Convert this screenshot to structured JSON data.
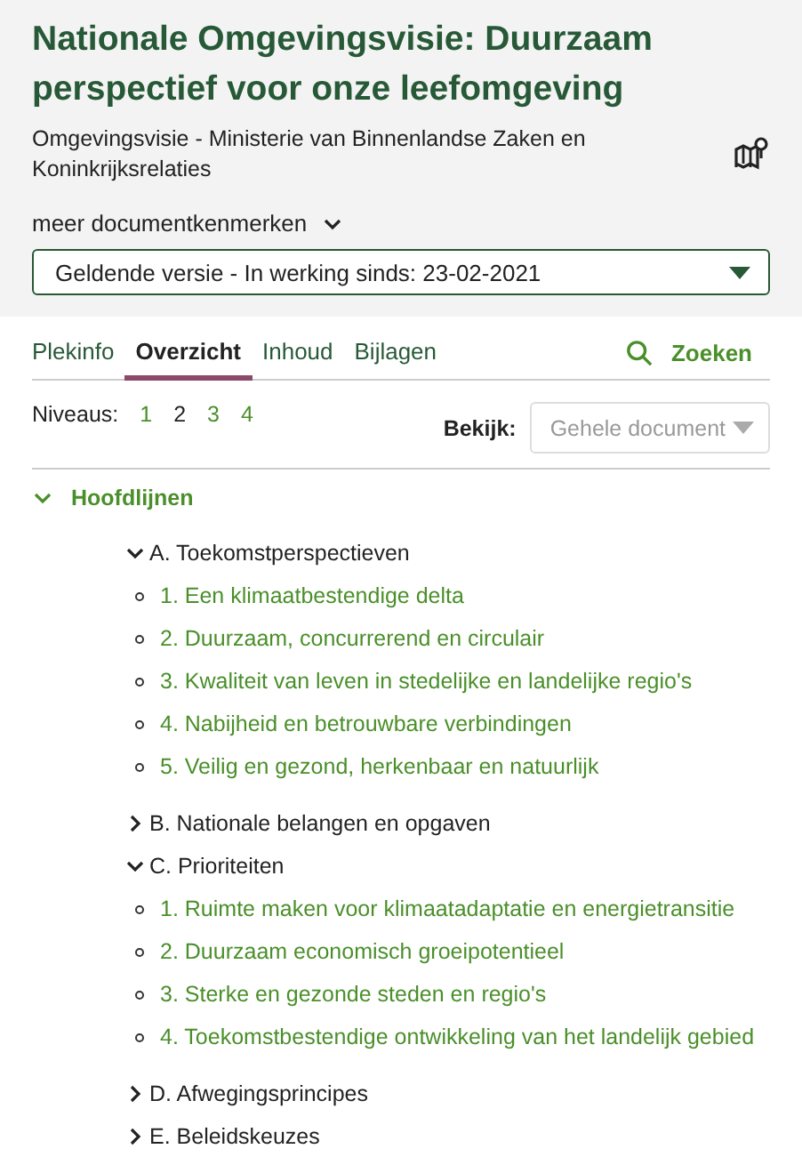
{
  "header": {
    "title": "Nationale Omgevingsvisie: Duurzaam perspectief voor onze leefomgeving",
    "subtitle": "Omgevingsvisie - Ministerie van Binnenlandse Zaken en Koninkrijksrelaties",
    "more_toggle": {
      "label": "meer documentkenmerken",
      "expanded": false
    },
    "version_select": {
      "value": "Geldende versie - In werking sinds: 23-02-2021"
    }
  },
  "tabs": [
    {
      "label": "Plekinfo",
      "selected": false
    },
    {
      "label": "Overzicht",
      "selected": true
    },
    {
      "label": "Inhoud",
      "selected": false
    },
    {
      "label": "Bijlagen",
      "selected": false
    }
  ],
  "search_link": {
    "label": "Zoeken"
  },
  "levels": {
    "label": "Niveaus:",
    "items": [
      {
        "label": "1",
        "selected": false
      },
      {
        "label": "2",
        "selected": true
      },
      {
        "label": "3",
        "selected": false
      },
      {
        "label": "4",
        "selected": false
      }
    ]
  },
  "view_select": {
    "label": "Bekijk:",
    "placeholder": "Gehele document",
    "disabled": true
  },
  "tree": [
    {
      "kind": "root",
      "label": "Hoofdlijnen",
      "expanded": true,
      "children": [
        {
          "kind": "section",
          "label": "A. Toekomstperspectieven",
          "expanded": true,
          "children": [
            {
              "kind": "link",
              "label": "1. Een klimaatbestendige delta"
            },
            {
              "kind": "link",
              "label": "2. Duurzaam, concurrerend en circulair"
            },
            {
              "kind": "link",
              "label": "3. Kwaliteit van leven in stedelijke en landelijke regio's"
            },
            {
              "kind": "link",
              "label": "4. Nabijheid en betrouwbare verbindingen"
            },
            {
              "kind": "link",
              "label": "5. Veilig en gezond, herkenbaar en natuurlijk"
            }
          ]
        },
        {
          "kind": "section",
          "label": "B. Nationale belangen en opgaven",
          "expanded": false
        },
        {
          "kind": "section",
          "label": "C. Prioriteiten",
          "expanded": true,
          "children": [
            {
              "kind": "link",
              "label": "1. Ruimte maken voor klimaatadaptatie en energietransitie"
            },
            {
              "kind": "link",
              "label": "2. Duurzaam economisch groeipotentieel"
            },
            {
              "kind": "link",
              "label": "3. Sterke en gezonde steden en regio's"
            },
            {
              "kind": "link",
              "label": "4. Toekomstbestendige ontwikkeling van het landelijk gebied"
            }
          ]
        },
        {
          "kind": "section",
          "label": "D. Afwegingsprincipes",
          "expanded": false
        },
        {
          "kind": "section",
          "label": "E. Beleidskeuzes",
          "expanded": false
        }
      ]
    }
  ]
}
